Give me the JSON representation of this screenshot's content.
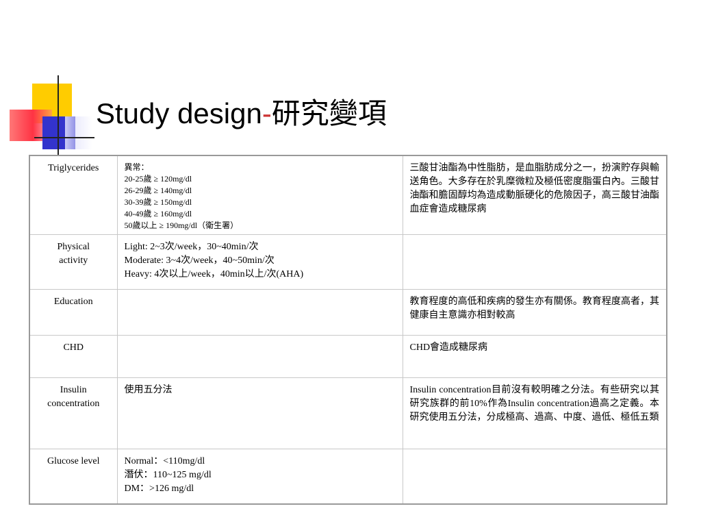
{
  "title": {
    "main": "Study design",
    "dash": "-",
    "zh": "研究變項"
  },
  "rows": [
    {
      "variable": "Triglycerides",
      "criteria": [
        "異常：",
        "20-25歲 ≥ 120mg/dl",
        "26-29歲 ≥ 140mg/dl",
        "30-39歲 ≥ 150mg/dl",
        "40-49歲 ≥ 160mg/dl",
        "50歲以上 ≥ 190mg/dl（衛生署）"
      ],
      "note": "三酸甘油酯為中性脂肪，是血脂肪成分之一，扮演貯存與輸送角色。大多存在於乳糜微粒及極低密度脂蛋白內。三酸甘油酯和膽固醇均為造成動脈硬化的危險因子，高三酸甘油酯血症會造成糖尿病"
    },
    {
      "variable_lines": [
        "Physical",
        "activity"
      ],
      "criteria": [
        "Light: 2~3次/week，30~40min/次",
        "Moderate: 3~4次/week，40~50min/次",
        "Heavy: 4次以上/week，40min以上/次(AHA)"
      ],
      "note": ""
    },
    {
      "variable": "Education",
      "criteria": [],
      "note": "教育程度的高低和疾病的發生亦有關係。教育程度高者，其健康自主意識亦相對較高"
    },
    {
      "variable": "CHD",
      "criteria": [],
      "note": "CHD會造成糖尿病"
    },
    {
      "variable_lines": [
        "Insulin",
        "concentration"
      ],
      "criteria": [
        "使用五分法"
      ],
      "note": "Insulin concentration目前沒有較明確之分法。有些研究以其研究族群的前10%作為Insulin concentration過高之定義。本研究使用五分法，分成極高、過高、中度、過低、極低五類"
    },
    {
      "variable": "Glucose level",
      "criteria": [
        "Normal：<110mg/dl",
        "潛伏：110~125 mg/dl",
        "DM：>126 mg/dl"
      ],
      "note": ""
    }
  ]
}
